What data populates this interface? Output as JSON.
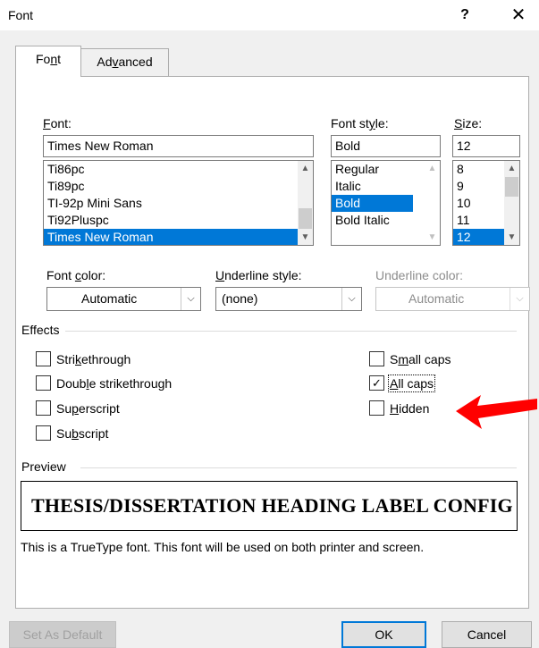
{
  "dialog": {
    "title": "Font",
    "help_label": "?",
    "close_label": "✕"
  },
  "tabs": [
    {
      "label_pre": "Fo",
      "label_key": "n",
      "label_post": "t",
      "selected": true
    },
    {
      "label_pre": "Ad",
      "label_key": "v",
      "label_post": "anced",
      "selected": false
    }
  ],
  "font": {
    "label_key": "F",
    "label_rest": "ont:",
    "value": "Times New Roman",
    "items": [
      "Ti86pc",
      "Ti89pc",
      "TI-92p Mini Sans",
      "Ti92Pluspc",
      "Times New Roman"
    ],
    "selected_index": 4
  },
  "font_style": {
    "label_pre": "Font st",
    "label_key": "y",
    "label_post": "le:",
    "value": "Bold",
    "items": [
      "Regular",
      "Italic",
      "Bold",
      "Bold Italic"
    ],
    "selected_index": 2
  },
  "size": {
    "label_key": "S",
    "label_rest": "ize:",
    "value": "12",
    "items": [
      "8",
      "9",
      "10",
      "11",
      "12"
    ],
    "selected_index": 4
  },
  "font_color": {
    "label_pre": "Font ",
    "label_key": "c",
    "label_post": "olor:",
    "value": "Automatic"
  },
  "underline_style": {
    "label_key": "U",
    "label_rest": "nderline style:",
    "value": "(none)"
  },
  "underline_color": {
    "label": "Underline color:",
    "value": "Automatic",
    "enabled": false
  },
  "effects": {
    "heading": "Effects",
    "strikethrough": {
      "pre": "Stri",
      "key": "k",
      "post": "ethrough",
      "checked": false
    },
    "double_strikethrough": {
      "pre": "Doub",
      "key": "l",
      "post": "e strikethrough",
      "checked": false
    },
    "superscript": {
      "pre": "Su",
      "key": "p",
      "post": "erscript",
      "checked": false
    },
    "subscript": {
      "pre": "Su",
      "key": "b",
      "post": "script",
      "checked": false
    },
    "small_caps": {
      "pre": "S",
      "key": "m",
      "post": "all caps",
      "checked": false
    },
    "all_caps": {
      "pre": "",
      "key": "A",
      "post": "ll caps",
      "checked": true
    },
    "hidden": {
      "pre": "",
      "key": "H",
      "post": "idden",
      "checked": false
    }
  },
  "preview": {
    "heading": "Preview",
    "text": "THESIS/DISSERTATION HEADING LABEL CONFIG",
    "note": "This is a TrueType font. This font will be used on both printer and screen."
  },
  "buttons": {
    "set_default": "Set As Default",
    "ok": "OK",
    "cancel": "Cancel"
  },
  "colors": {
    "selection": "#0078d7",
    "annotation_arrow": "#ff0000"
  },
  "icons": {
    "scroll_up": "▲",
    "scroll_down": "▼",
    "combo_arrow": "⌵",
    "checkmark": "✓"
  }
}
